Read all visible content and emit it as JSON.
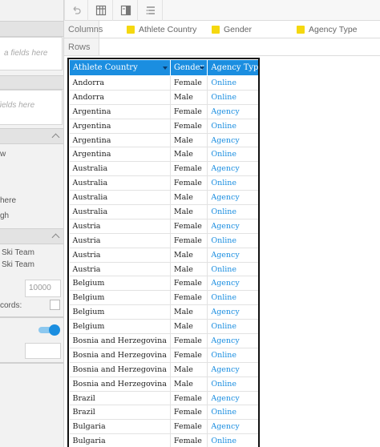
{
  "sidebar": {
    "hint1": "a fields here",
    "hint2": "fields here",
    "opt1": "w",
    "opt2": "here",
    "opt3": "gh",
    "team1": "Ski Team",
    "team2": "Ski Team",
    "limit_value": "10000",
    "records_label": "cords:"
  },
  "zones": {
    "columns_label": "Columns",
    "rows_label": "Rows",
    "columns_fields": [
      "Athlete Country",
      "Gender",
      "Agency Type"
    ]
  },
  "table": {
    "headers": [
      "Athlete Country",
      "Gender",
      "Agency Type"
    ],
    "rows": [
      [
        "Andorra",
        "Female",
        "Online"
      ],
      [
        "Andorra",
        "Male",
        "Online"
      ],
      [
        "Argentina",
        "Female",
        "Agency"
      ],
      [
        "Argentina",
        "Female",
        "Online"
      ],
      [
        "Argentina",
        "Male",
        "Agency"
      ],
      [
        "Argentina",
        "Male",
        "Online"
      ],
      [
        "Australia",
        "Female",
        "Agency"
      ],
      [
        "Australia",
        "Female",
        "Online"
      ],
      [
        "Australia",
        "Male",
        "Agency"
      ],
      [
        "Australia",
        "Male",
        "Online"
      ],
      [
        "Austria",
        "Female",
        "Agency"
      ],
      [
        "Austria",
        "Female",
        "Online"
      ],
      [
        "Austria",
        "Male",
        "Agency"
      ],
      [
        "Austria",
        "Male",
        "Online"
      ],
      [
        "Belgium",
        "Female",
        "Agency"
      ],
      [
        "Belgium",
        "Female",
        "Online"
      ],
      [
        "Belgium",
        "Male",
        "Agency"
      ],
      [
        "Belgium",
        "Male",
        "Online"
      ],
      [
        "Bosnia and Herzegovina",
        "Female",
        "Agency"
      ],
      [
        "Bosnia and Herzegovina",
        "Female",
        "Online"
      ],
      [
        "Bosnia and Herzegovina",
        "Male",
        "Agency"
      ],
      [
        "Bosnia and Herzegovina",
        "Male",
        "Online"
      ],
      [
        "Brazil",
        "Female",
        "Agency"
      ],
      [
        "Brazil",
        "Female",
        "Online"
      ],
      [
        "Bulgaria",
        "Female",
        "Agency"
      ],
      [
        "Bulgaria",
        "Female",
        "Online"
      ]
    ]
  },
  "icons": {
    "toolbar": [
      "undo-icon",
      "table-layout-icon",
      "column-view-icon",
      "list-settings-icon"
    ]
  },
  "colors": {
    "header_blue": "#1b8ee0",
    "agency_text": "#1b8ee0",
    "field_yellow": "#f5d80f"
  }
}
